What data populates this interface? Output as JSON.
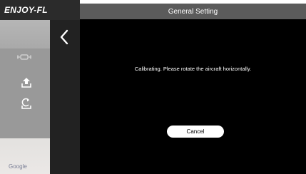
{
  "brand": {
    "logo_text": "ENJOY-FL"
  },
  "map": {
    "attribution": "Google"
  },
  "toolbar": {
    "icons": [
      "aircraft-icon",
      "takeoff-icon",
      "return-home-icon"
    ]
  },
  "navigation": {
    "back_icon": "chevron-left-icon"
  },
  "dialog": {
    "title": "General Setting",
    "message": "Calibrating. Please rotate the aircraft horizontally.",
    "cancel_label": "Cancel"
  },
  "colors": {
    "dialog_background": "#000000",
    "dialog_header": "#5b5b5b",
    "brand_bar": "#2b2b2b",
    "back_strip": "#222222",
    "map_gray": "#999999",
    "button_background": "#ffffff"
  }
}
